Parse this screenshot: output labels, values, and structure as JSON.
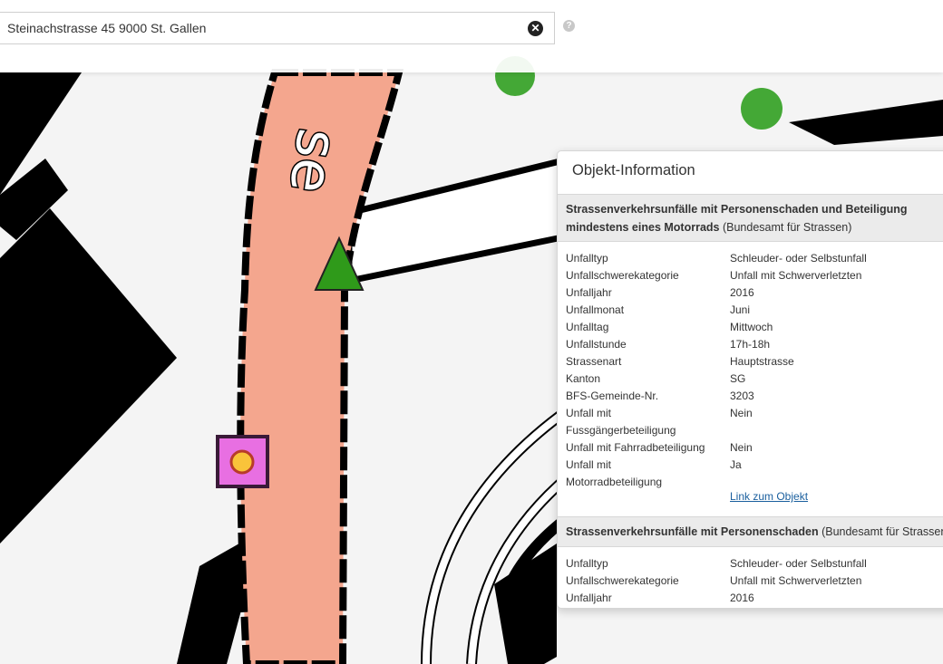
{
  "search": {
    "value": "Steinachstrasse 45 9000 St. Gallen"
  },
  "icons": {
    "clear": "close-circle-icon",
    "help": "question-circle-icon"
  },
  "map": {
    "road_label": "se",
    "colors": {
      "road": "#f4a68e",
      "building": "#000000",
      "vegetation_marker": "#44a836",
      "triangle_marker": "#2f9a1a",
      "square_marker": "#e86fe2",
      "circle_marker": "#f9c33a"
    }
  },
  "popup": {
    "title": "Objekt-Information",
    "section1": {
      "title_bold_1": "Strassenverkehrsunfälle mit Personenschaden und Beteiligung",
      "title_bold_2": "mindestens eines Motorrads",
      "source": "(Bundesamt für Strassen)",
      "rows": [
        {
          "k": "Unfalltyp",
          "v": "Schleuder- oder Selbstunfall"
        },
        {
          "k": "Unfallschwerekategorie",
          "v": "Unfall mit Schwerverletzten"
        },
        {
          "k": "Unfalljahr",
          "v": "2016"
        },
        {
          "k": "Unfallmonat",
          "v": "Juni"
        },
        {
          "k": "Unfalltag",
          "v": "Mittwoch"
        },
        {
          "k": "Unfallstunde",
          "v": "17h-18h"
        },
        {
          "k": "Strassenart",
          "v": "Hauptstrasse"
        },
        {
          "k": "Kanton",
          "v": "SG"
        },
        {
          "k": "BFS-Gemeinde-Nr.",
          "v": "3203"
        },
        {
          "k": "Unfall mit",
          "v": "Nein"
        },
        {
          "k": "Fussgängerbeteiligung",
          "v": ""
        },
        {
          "k": "Unfall mit Fahrradbeteiligung",
          "v": "Nein"
        },
        {
          "k": "Unfall mit",
          "v": "Ja"
        },
        {
          "k": "Motorradbeteiligung",
          "v": ""
        }
      ],
      "link": "Link zum Objekt"
    },
    "section2": {
      "title_bold": "Strassenverkehrsunfälle mit Personenschaden",
      "source": "(Bundesamt für Strassen)",
      "rows": [
        {
          "k": "Unfalltyp",
          "v": "Schleuder- oder Selbstunfall"
        },
        {
          "k": "Unfallschwerekategorie",
          "v": "Unfall mit Schwerverletzten"
        },
        {
          "k": "Unfalljahr",
          "v": "2016"
        }
      ]
    }
  }
}
